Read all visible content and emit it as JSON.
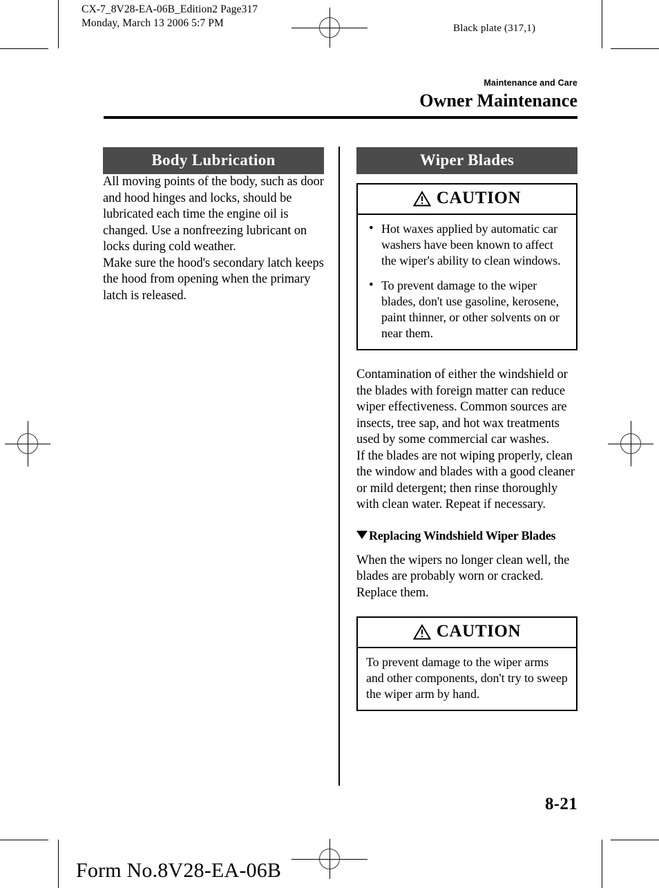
{
  "print_marks": {
    "slug_left": "CX-7_8V28-EA-06B_Edition2 Page317\nMonday, March 13 2006 5:7 PM",
    "slug_right": "Black plate (317,1)"
  },
  "running_head": {
    "chapter": "Maintenance and Care",
    "section": "Owner Maintenance"
  },
  "left_column": {
    "section_title": "Body Lubrication",
    "paragraphs": [
      "All moving points of the body, such as door and hood hinges and locks, should be lubricated each time the engine oil is changed. Use a nonfreezing lubricant on locks during cold weather.",
      "Make sure the hood's secondary latch keeps the hood from opening when the primary latch is released."
    ]
  },
  "right_column": {
    "section_title": "Wiper Blades",
    "caution_1": {
      "icon": "warning-triangle-icon",
      "title": "CAUTION",
      "bullets": [
        "Hot waxes applied by automatic car washers have been known to affect the wiper's ability to clean windows.",
        "To prevent damage to the wiper blades, don't use gasoline, kerosene, paint thinner, or other solvents on or near them."
      ],
      "bullet_glyph": "•"
    },
    "paragraphs": [
      "Contamination of either the windshield or the blades with foreign matter can reduce wiper effectiveness. Common sources are insects, tree sap, and hot wax treatments used by some commercial car washes.",
      "If the blades are not wiping properly, clean the window and blades with a good cleaner or mild detergent; then rinse thoroughly with clean water. Repeat if necessary."
    ],
    "subheading": {
      "marker": "triangle-down-icon",
      "text": "Replacing Windshield Wiper Blades"
    },
    "subsection_paragraph": "When the wipers no longer clean well, the blades are probably worn or cracked. Replace them.",
    "caution_2": {
      "icon": "warning-triangle-icon",
      "title": "CAUTION",
      "body": "To prevent damage to the wiper arms and other components, don't try to sweep the wiper arm by hand."
    }
  },
  "footer": {
    "page_number": "8-21",
    "form_number": "Form No.8V28-EA-06B"
  },
  "colors": {
    "section_bar_bg": "#4b4b4b",
    "section_bar_text": "#ffffff",
    "rule": "#000000"
  }
}
